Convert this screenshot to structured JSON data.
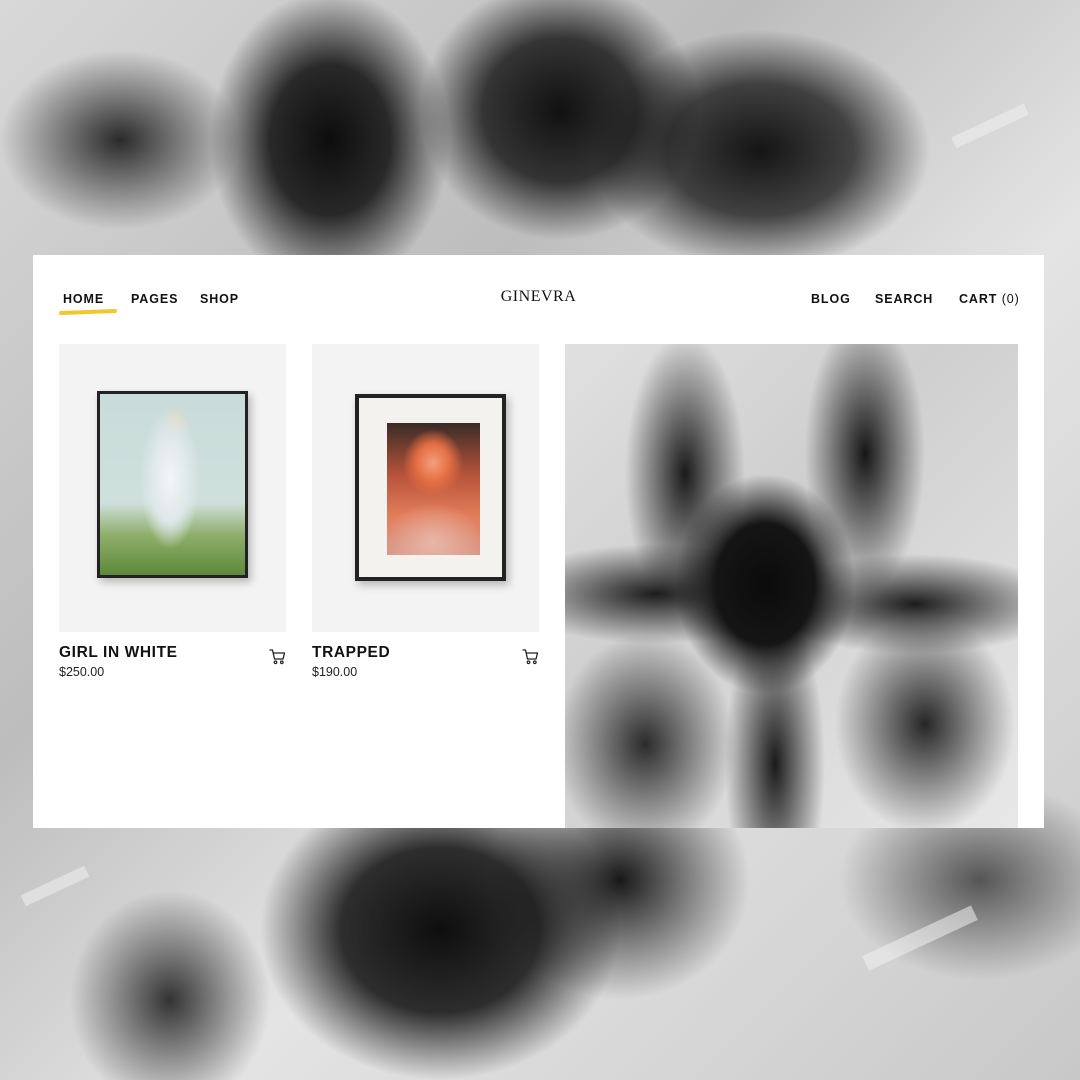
{
  "nav": {
    "left": [
      "HOME",
      "PAGES",
      "SHOP"
    ],
    "brand": "GINEVRA",
    "right": {
      "blog": "BLOG",
      "search": "SEARCH",
      "cart": "CART",
      "cart_count": "(0)"
    },
    "active": "HOME",
    "active_underline_color": "#f2c62d"
  },
  "products": [
    {
      "name": "GIRL IN WHITE",
      "price": "$250.00",
      "icon": "cart-icon"
    },
    {
      "name": "TRAPPED",
      "price": "$190.00",
      "icon": "cart-icon"
    }
  ],
  "colors": {
    "card_background": "#ffffff",
    "thumb_background": "#f4f3f3",
    "text": "#111111"
  }
}
